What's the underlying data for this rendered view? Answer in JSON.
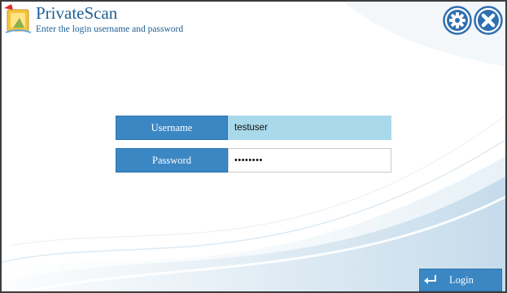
{
  "app": {
    "title": "PrivateScan",
    "subtitle": "Enter the login username and password"
  },
  "header": {
    "settings_icon": "gear-icon",
    "close_icon": "close-icon"
  },
  "form": {
    "username_label": "Username",
    "username_value": "testuser",
    "password_label": "Password",
    "password_value": "••••••••"
  },
  "footer": {
    "login_label": "Login",
    "login_icon": "enter-arrow-icon"
  },
  "colors": {
    "accent": "#3b87c4",
    "title": "#1e5f96",
    "username_field_bg": "#a9d9ea"
  }
}
